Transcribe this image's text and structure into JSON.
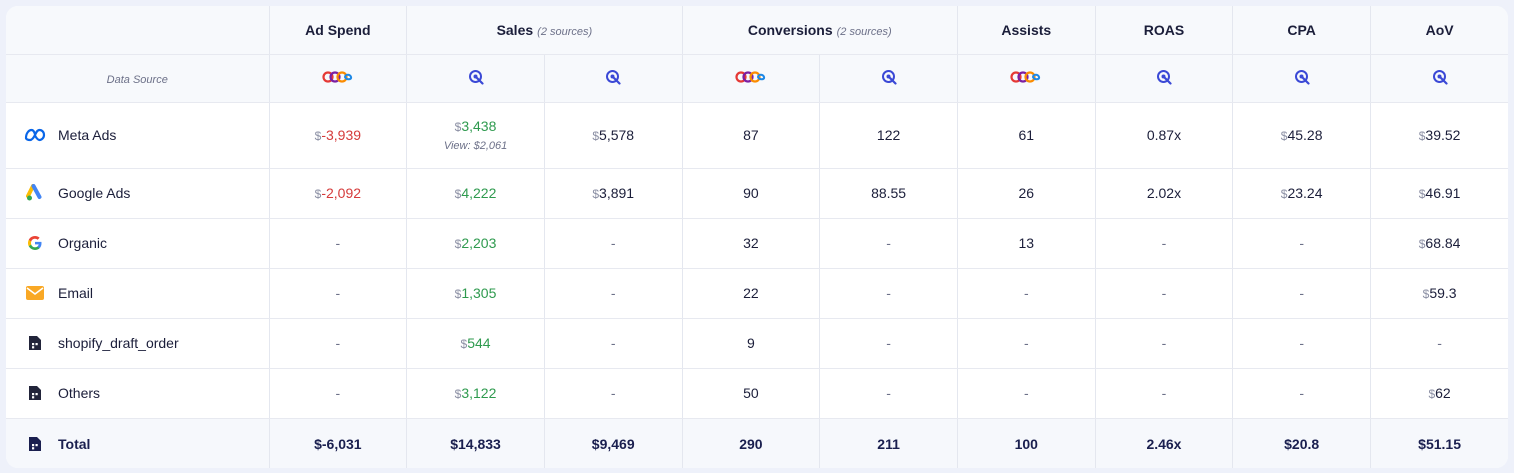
{
  "header": {
    "columns": [
      {
        "label": "Ad Spend",
        "note": "",
        "span": 1
      },
      {
        "label": "Sales",
        "note": "(2 sources)",
        "span": 2
      },
      {
        "label": "Conversions",
        "note": "(2 sources)",
        "span": 2
      },
      {
        "label": "Assists",
        "note": "",
        "span": 1
      },
      {
        "label": "ROAS",
        "note": "",
        "span": 1
      },
      {
        "label": "CPA",
        "note": "",
        "span": 1
      },
      {
        "label": "AoV",
        "note": "",
        "span": 1
      }
    ],
    "data_source_label": "Data Source",
    "sources": [
      "platform-logo-icon",
      "tracker-logo-icon",
      "tracker-logo-icon",
      "platform-logo-icon",
      "tracker-logo-icon",
      "platform-logo-icon",
      "tracker-logo-icon",
      "tracker-logo-icon",
      "tracker-logo-icon"
    ]
  },
  "currency_symbol": "$",
  "dash": "-",
  "rows": [
    {
      "name": "Meta Ads",
      "icon": "meta-icon",
      "ad_spend": "-3,939",
      "sales_tracked": "3,438",
      "sales_view": "View: $2,061",
      "sales_platform": "5,578",
      "conv_tracked": "87",
      "conv_platform": "122",
      "assists": "61",
      "roas": "0.87x",
      "cpa": "45.28",
      "aov": "39.52"
    },
    {
      "name": "Google Ads",
      "icon": "google-ads-icon",
      "ad_spend": "-2,092",
      "sales_tracked": "4,222",
      "sales_view": "",
      "sales_platform": "3,891",
      "conv_tracked": "90",
      "conv_platform": "88.55",
      "assists": "26",
      "roas": "2.02x",
      "cpa": "23.24",
      "aov": "46.91"
    },
    {
      "name": "Organic",
      "icon": "google-g-icon",
      "ad_spend": "",
      "sales_tracked": "2,203",
      "sales_view": "",
      "sales_platform": "",
      "conv_tracked": "32",
      "conv_platform": "",
      "assists": "13",
      "roas": "",
      "cpa": "",
      "aov": "68.84"
    },
    {
      "name": "Email",
      "icon": "email-icon",
      "ad_spend": "",
      "sales_tracked": "1,305",
      "sales_view": "",
      "sales_platform": "",
      "conv_tracked": "22",
      "conv_platform": "",
      "assists": "",
      "roas": "",
      "cpa": "",
      "aov": "59.3"
    },
    {
      "name": "shopify_draft_order",
      "icon": "document-icon",
      "ad_spend": "",
      "sales_tracked": "544",
      "sales_view": "",
      "sales_platform": "",
      "conv_tracked": "9",
      "conv_platform": "",
      "assists": "",
      "roas": "",
      "cpa": "",
      "aov": ""
    },
    {
      "name": "Others",
      "icon": "document-icon",
      "ad_spend": "",
      "sales_tracked": "3,122",
      "sales_view": "",
      "sales_platform": "",
      "conv_tracked": "50",
      "conv_platform": "",
      "assists": "",
      "roas": "",
      "cpa": "",
      "aov": "62"
    }
  ],
  "total": {
    "name": "Total",
    "icon": "document-icon",
    "ad_spend": "$-6,031",
    "sales_tracked": "$14,833",
    "sales_platform": "$9,469",
    "conv_tracked": "290",
    "conv_platform": "211",
    "assists": "100",
    "roas": "2.46x",
    "cpa": "$20.8",
    "aov": "$51.15"
  },
  "colors": {
    "negative": "#d53a3a",
    "positive": "#2e9a4e",
    "tracker_icon": "#3b49d6",
    "total_text": "#1a1f4f"
  }
}
